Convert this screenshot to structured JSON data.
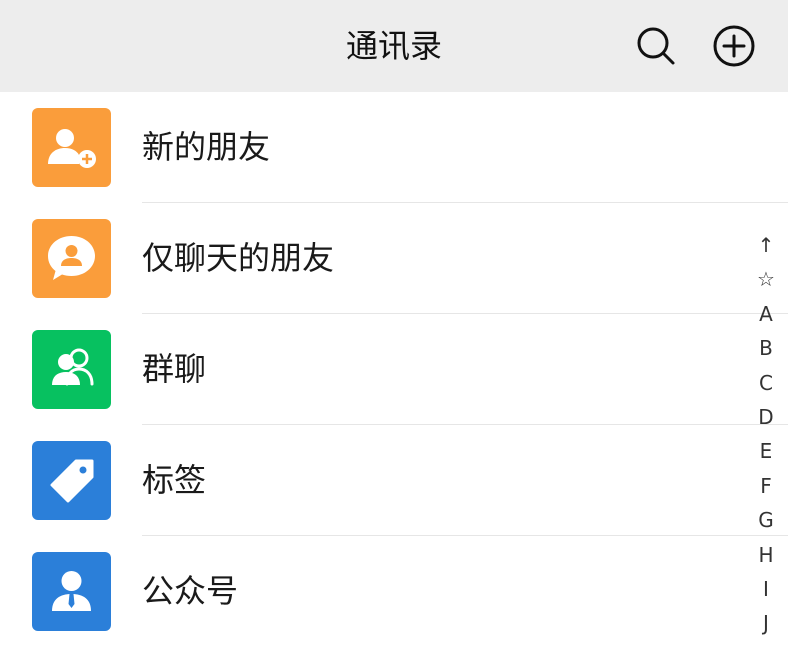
{
  "header": {
    "title": "通讯录",
    "search_icon": "search-icon",
    "add_icon": "plus-circle-icon"
  },
  "items": [
    {
      "label": "新的朋友",
      "icon": "add-friend-icon",
      "color": "#fa9d3b"
    },
    {
      "label": "仅聊天的朋友",
      "icon": "chat-only-friend-icon",
      "color": "#fa9d3b"
    },
    {
      "label": "群聊",
      "icon": "group-chat-icon",
      "color": "#07c160"
    },
    {
      "label": "标签",
      "icon": "tag-icon",
      "color": "#2b7fd9"
    },
    {
      "label": "公众号",
      "icon": "official-account-icon",
      "color": "#2b7fd9"
    }
  ],
  "index_bar": [
    "↑",
    "☆",
    "A",
    "B",
    "C",
    "D",
    "E",
    "F",
    "G",
    "H",
    "I",
    "J"
  ]
}
